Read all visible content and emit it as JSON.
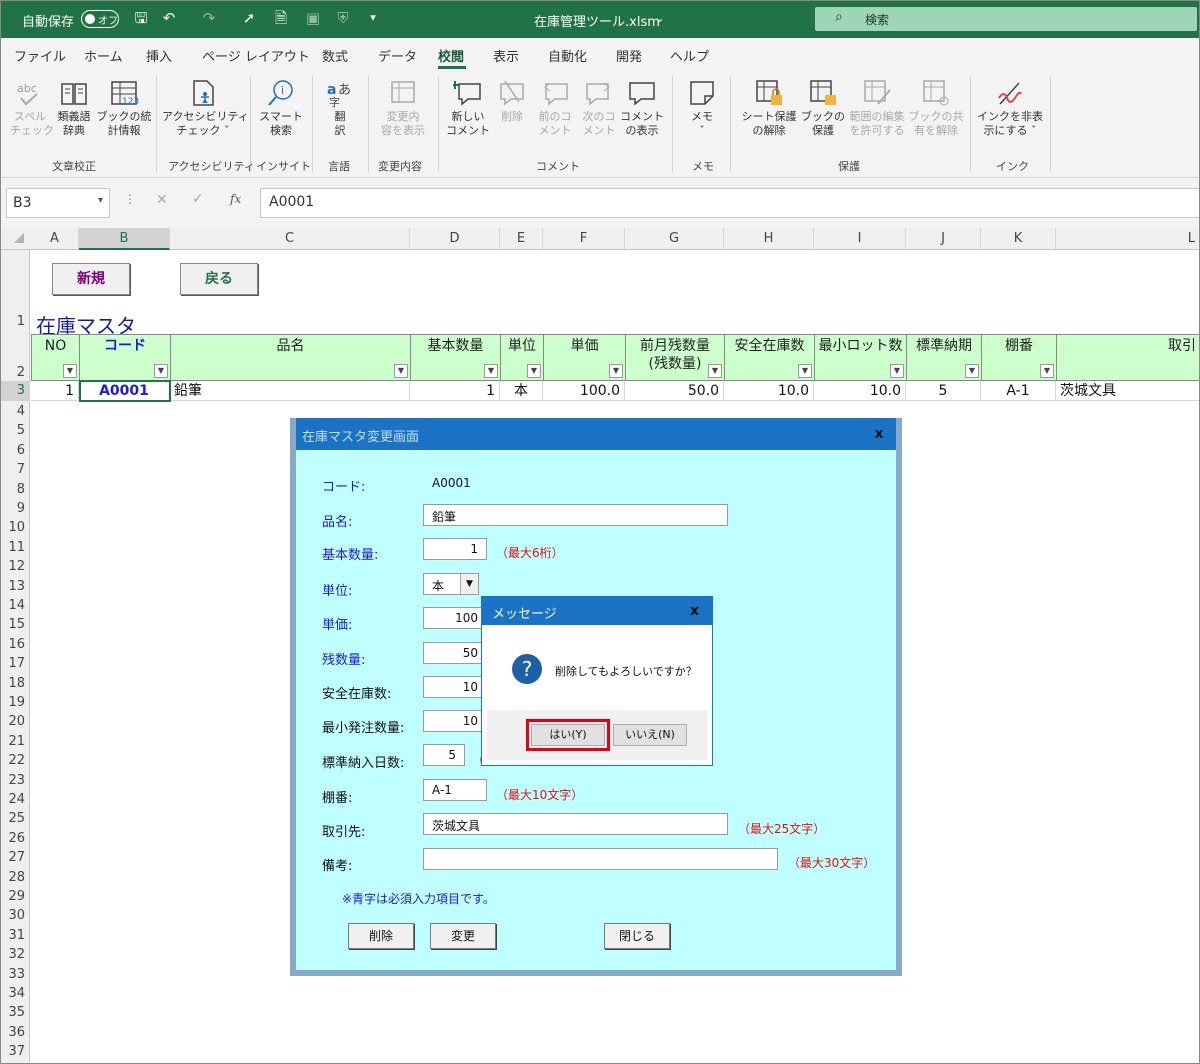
{
  "titlebar": {
    "autosave_label": "自動保存",
    "autosave_state": "オフ",
    "filename": "在庫管理ツール.xlsm",
    "search_placeholder": "検索"
  },
  "menu": [
    "ファイル",
    "ホーム",
    "挿入",
    "ページ レイアウト",
    "数式",
    "データ",
    "校閲",
    "表示",
    "自動化",
    "開発",
    "ヘルプ"
  ],
  "active_menu": "校閲",
  "ribbon": {
    "buttons": [
      {
        "line1": "スペル",
        "line2": "チェック",
        "disabled": true
      },
      {
        "line1": "類義語",
        "line2": "辞典",
        "disabled": false
      },
      {
        "line1": "ブックの統",
        "line2": "計情報",
        "disabled": false
      },
      {
        "line1": "アクセシビリティ",
        "line2": "チェック ˇ",
        "disabled": false
      },
      {
        "line1": "スマート",
        "line2": "検索",
        "disabled": false
      },
      {
        "line1": "翻",
        "line2": "訳",
        "disabled": false
      },
      {
        "line1": "変更内",
        "line2": "容を表示",
        "disabled": true
      },
      {
        "line1": "新しい",
        "line2": "コメント",
        "disabled": false
      },
      {
        "line1": "削除",
        "line2": "",
        "disabled": true
      },
      {
        "line1": "前のコ",
        "line2": "メント",
        "disabled": true
      },
      {
        "line1": "次のコ",
        "line2": "メント",
        "disabled": true
      },
      {
        "line1": "コメント",
        "line2": "の表示",
        "disabled": false
      },
      {
        "line1": "メモ",
        "line2": "ˇ",
        "disabled": false
      },
      {
        "line1": "シート保護",
        "line2": "の解除",
        "disabled": false
      },
      {
        "line1": "ブックの",
        "line2": "保護",
        "disabled": false
      },
      {
        "line1": "範囲の編集",
        "line2": "を許可する",
        "disabled": true
      },
      {
        "line1": "ブックの共",
        "line2": "有を解除",
        "disabled": true
      },
      {
        "line1": "インクを非表",
        "line2": "示にする ˇ",
        "disabled": false
      }
    ],
    "groups": [
      "文章校正",
      "アクセシビリティ",
      "インサイト",
      "言語",
      "変更内容",
      "コメント",
      "メモ",
      "保護",
      "インク"
    ]
  },
  "formula_bar": {
    "name_box": "B3",
    "fx": "fx",
    "value": "A0001"
  },
  "columns": [
    "A",
    "B",
    "C",
    "D",
    "E",
    "F",
    "G",
    "H",
    "I",
    "J",
    "K",
    "L"
  ],
  "rows": [
    "1",
    "2",
    "3",
    "4",
    "5",
    "6",
    "7",
    "8",
    "9",
    "10",
    "11",
    "12",
    "13",
    "14",
    "15",
    "16",
    "17",
    "18",
    "19",
    "20",
    "21",
    "22",
    "23",
    "24",
    "25",
    "26",
    "27",
    "28",
    "29",
    "30",
    "31",
    "32",
    "33",
    "34",
    "35",
    "36",
    "37"
  ],
  "sheet": {
    "new_button": "新規",
    "back_button": "戻る",
    "title": "在庫マスタ",
    "headers": [
      "NO",
      "コード",
      "品名",
      "基本数量",
      "単位",
      "単価",
      "前月残数量\n(残数量)",
      "安全在庫数",
      "最小ロット数",
      "標準納期",
      "棚番",
      "取引"
    ],
    "row3": [
      "1",
      "A0001",
      "鉛筆",
      "1",
      "本",
      "100.0",
      "50.0",
      "10.0",
      "10.0",
      "5",
      "A-1",
      "茨城文具"
    ]
  },
  "userform": {
    "title": "在庫マスタ変更画面",
    "close": "x",
    "fields": {
      "code_label": "コード:",
      "code_value": "A0001",
      "name_label": "品名:",
      "name_value": "鉛筆",
      "qty_label": "基本数量:",
      "qty_value": "1",
      "qty_note": "（最大6桁）",
      "unit_label": "単位:",
      "unit_value": "本",
      "price_label": "単価:",
      "price_value": "100",
      "remain_label": "残数量:",
      "remain_value": "50",
      "safety_label": "安全在庫数:",
      "safety_value": "10",
      "minorder_label": "最小発注数量:",
      "minorder_value": "10",
      "lead_label": "標準納入日数:",
      "lead_value": "5",
      "lead_note": "（",
      "shelf_label": "棚番:",
      "shelf_value": "A-1",
      "shelf_note": "（最大10文字）",
      "supplier_label": "取引先:",
      "supplier_value": "茨城文具",
      "supplier_note": "（最大25文字）",
      "memo_label": "備考:",
      "memo_value": "",
      "memo_note": "（最大30文字）"
    },
    "required_note": "※青字は必須入力項目です。",
    "delete_button": "削除",
    "change_button": "変更",
    "close_button": "閉じる"
  },
  "messagebox": {
    "title": "メッセージ",
    "close": "x",
    "message": "削除してもよろしいですか？",
    "yes": "はい(Y)",
    "no": "いいえ(N)"
  },
  "colors": {
    "excel_green": "#217346",
    "header_fill": "#ccffcc",
    "form_bg": "#c0ffff",
    "title_blue": "#1b73c6",
    "highlight_red": "#e60012"
  }
}
